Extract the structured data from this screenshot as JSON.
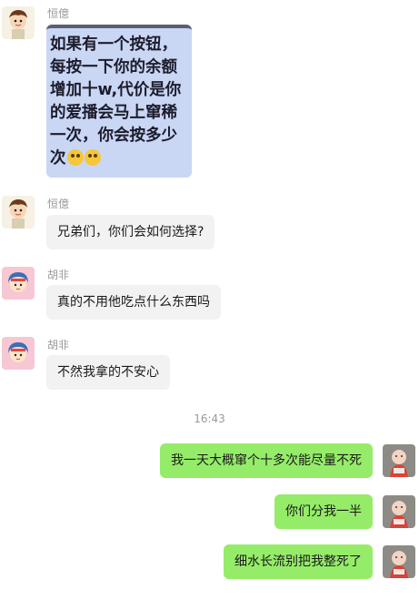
{
  "messages": [
    {
      "sender": "恒億",
      "image_text": "如果有一个按钮，每按一下你的余额增加十w,代价是你的爱播会马上窜稀一次，你会按多少次",
      "image_emojis": [
        "flushed-face-emoji",
        "flushed-face-emoji"
      ]
    },
    {
      "sender": "恒億",
      "text": "兄弟们，你们会如何选择?"
    },
    {
      "sender": "胡非",
      "text": "真的不用他吃点什么东西吗"
    },
    {
      "sender": "胡非",
      "text": "不然我拿的不安心"
    }
  ],
  "timestamp": "16:43",
  "outgoing": [
    {
      "text": "我一天大概窜个十多次能尽量不死"
    },
    {
      "text": "你们分我一半"
    },
    {
      "text": "细水长流别把我整死了"
    }
  ],
  "colors": {
    "incoming_bubble": "#f2f2f2",
    "outgoing_bubble": "#95ec69",
    "image_bg": "#c9d6f4"
  },
  "icons": {
    "avatar_hengyi": "cartoon-boy-avatar",
    "avatar_hufei": "cartoon-girl-avatar",
    "avatar_self": "baby-photo-avatar"
  }
}
